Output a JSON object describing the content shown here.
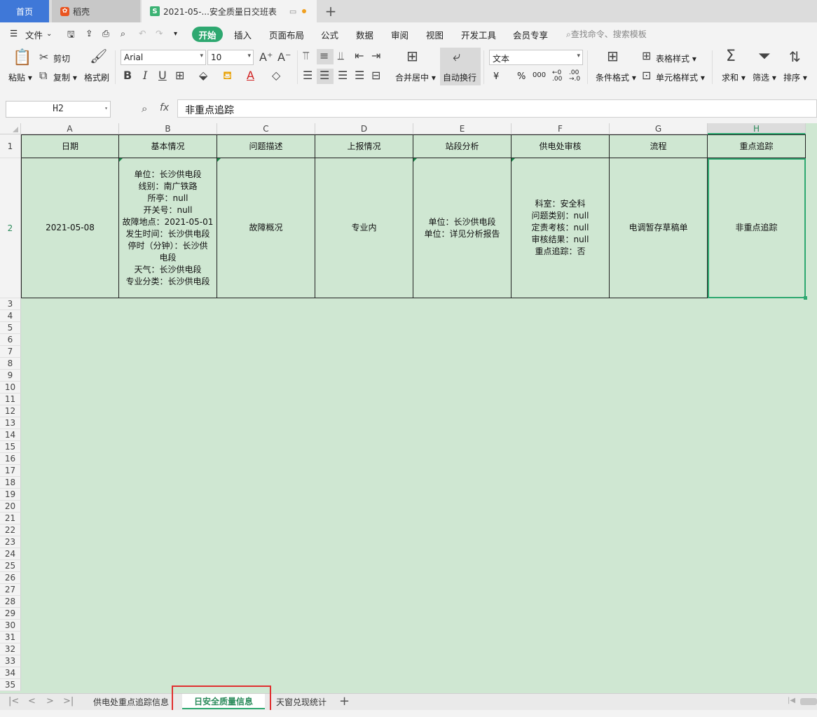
{
  "tabs": {
    "home": "首页",
    "daoke": "稻壳",
    "doc": "2021-05-...安全质量日交班表",
    "add": "+"
  },
  "menu": {
    "file": "文件",
    "start": "开始",
    "items": [
      "插入",
      "页面布局",
      "公式",
      "数据",
      "审阅",
      "视图",
      "开发工具",
      "会员专享"
    ],
    "search_placeholder": "查找命令、搜索模板"
  },
  "ribbon": {
    "paste": "粘贴",
    "cut": "剪切",
    "copy": "复制",
    "format_painter": "格式刷",
    "font_name": "Arial",
    "font_size": "10",
    "merge_center": "合并居中",
    "wrap_text": "自动换行",
    "number_format": "文本",
    "currency": "¥",
    "percent": "%",
    "thousands": "000",
    "conditional_format": "条件格式",
    "table_style": "表格样式",
    "cell_style": "单元格样式",
    "sum": "求和",
    "filter": "筛选",
    "sort": "排序"
  },
  "formula_bar": {
    "cell_ref": "H2",
    "fx": "fx",
    "content": "非重点追踪"
  },
  "columns": [
    "A",
    "B",
    "C",
    "D",
    "E",
    "F",
    "G",
    "H"
  ],
  "active_column": "H",
  "header_row": [
    "日期",
    "基本情况",
    "问题描述",
    "上报情况",
    "站段分析",
    "供电处审核",
    "流程",
    "重点追踪"
  ],
  "data_row": [
    "2021-05-08",
    "单位：长沙供电段\n线别：南广铁路\n所亭：null\n开关号：null\n故障地点：2021-05-01\n发生时间：长沙供电段\n停时（分钟）：长沙供\n电段\n天气：长沙供电段\n专业分类：长沙供电段",
    "故障概况",
    "专业内",
    "单位：长沙供电段\n单位：详见分析报告",
    "科室：安全科\n问题类别：null\n定责考核：null\n审核结果：null\n重点追踪：否",
    "电调暂存草稿单",
    "非重点追踪"
  ],
  "row_numbers": [
    "1",
    "2",
    "3",
    "4",
    "5",
    "6",
    "7",
    "8",
    "9",
    "10",
    "11",
    "12",
    "13",
    "14",
    "15",
    "16",
    "17",
    "18",
    "19",
    "20",
    "21",
    "22",
    "23",
    "24",
    "25",
    "26",
    "27",
    "28",
    "29",
    "30",
    "31",
    "32",
    "33",
    "34",
    "35"
  ],
  "sheets": [
    "供电处重点追踪信息",
    "日安全质量信息",
    "天窗兑现统计"
  ],
  "active_sheet": "日安全质量信息",
  "colors": {
    "accent": "#2ea870",
    "cell_fill": "#cfe7d2",
    "home_tab": "#3f78d8",
    "highlight_box": "#e03030"
  }
}
